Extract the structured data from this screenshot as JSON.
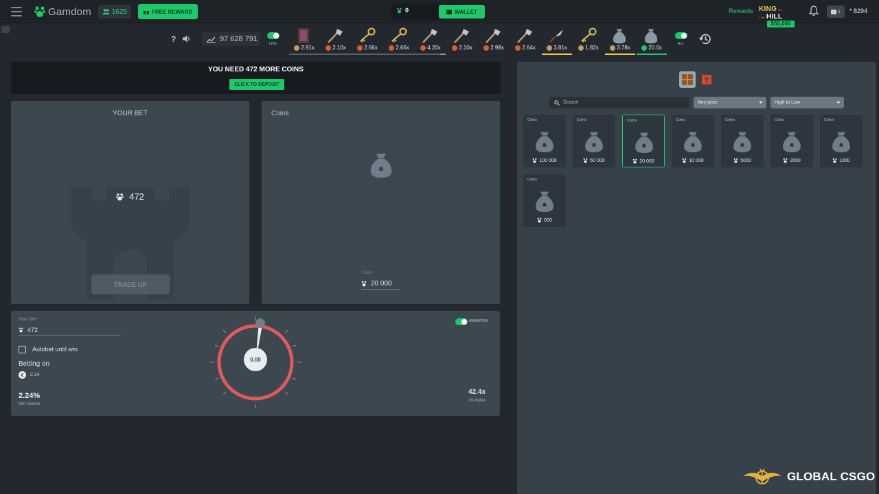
{
  "header": {
    "logo": "Gamdom",
    "online_count": "1625",
    "free_reward": "FREE REWARD",
    "wallet_balance": "0",
    "wallet_label": "WALLET",
    "rewards": "Rewards",
    "koth_king": "KING",
    "koth_of": "OF THE",
    "koth_hill": "HILL",
    "koth_prize": "$50,000",
    "inventory_count": "1",
    "balance": "* 8294"
  },
  "live_bar": {
    "help": "?",
    "stat_value": "97 628 791",
    "live_label": "LIVE",
    "all_label": "ALL",
    "drops": [
      {
        "multiplier": "2.91x",
        "item": "case-item",
        "src_color": "#c89b5b",
        "underline": "#8a96a0"
      },
      {
        "multiplier": "2.10x",
        "item": "axe-item",
        "src_color": "#e25a2a",
        "underline": "#8a96a0"
      },
      {
        "multiplier": "2.66x",
        "item": "key-item",
        "src_color": "#e25a2a",
        "underline": "#8a96a0"
      },
      {
        "multiplier": "2.66x",
        "item": "key-item",
        "src_color": "#e25a2a",
        "underline": "#8a96a0"
      },
      {
        "multiplier": "4.20x",
        "item": "axe-item",
        "src_color": "#e25a2a",
        "underline": "#8a96a0"
      },
      {
        "multiplier": "2.10x",
        "item": "axe-item",
        "src_color": "#e25a2a",
        "underline": ""
      },
      {
        "multiplier": "2.98x",
        "item": "axe-item",
        "src_color": "#e25a2a",
        "underline": ""
      },
      {
        "multiplier": "2.64x",
        "item": "axe-item",
        "src_color": "#e25a2a",
        "underline": ""
      },
      {
        "multiplier": "3.81x",
        "item": "knife-item",
        "src_color": "#c89b5b",
        "underline": "#f3c74a"
      },
      {
        "multiplier": "1.82x",
        "item": "key-item",
        "src_color": "#c89b5b",
        "underline": ""
      },
      {
        "multiplier": "3.78x",
        "item": "bag-item",
        "src_color": "#c89b5b",
        "underline": "#f3c74a"
      },
      {
        "multiplier": "20.0x",
        "item": "bag-item",
        "src_color": "#1ec96a",
        "underline": "#1ec96a"
      }
    ]
  },
  "notice": {
    "text": "YOU NEED 472 MORE COINS",
    "button": "CLICK TO DEPOSIT"
  },
  "bet_panel": {
    "title": "YOUR BET",
    "amount": "472",
    "button": "TRADE UP"
  },
  "coins_panel": {
    "title": "Coins",
    "sublabel": "Coins",
    "value": "20 000"
  },
  "controls": {
    "your_bet_label": "Your bet",
    "your_bet_value": "472",
    "autobet_label": "Autobet until win",
    "betting_on_label": "Betting on",
    "betting_on_value": "2.24",
    "win_chance": "2.24%",
    "win_chance_label": "Win chance",
    "dial_value": "0.00",
    "animation_label": "ANIMATION",
    "multiplier": "42.4x",
    "multiplier_label": "Multiplier"
  },
  "shop": {
    "search_placeholder": "Search",
    "price_filter": "Any price",
    "sort": "High to Low",
    "items": [
      {
        "title": "Coins",
        "price": "100 000"
      },
      {
        "title": "Coins",
        "price": "50 000"
      },
      {
        "title": "Coins",
        "price": "20 000",
        "selected": true
      },
      {
        "title": "Coins",
        "price": "10 000"
      },
      {
        "title": "Coins",
        "price": "5000"
      },
      {
        "title": "Coins",
        "price": "2000"
      },
      {
        "title": "Coins",
        "price": "1000"
      },
      {
        "title": "Coins",
        "price": "500"
      }
    ]
  },
  "watermark": "GLOBAL CSGO",
  "colors": {
    "accent": "#1ec96a",
    "panel": "#3c4750",
    "dial_ring": "#e05a5a"
  }
}
